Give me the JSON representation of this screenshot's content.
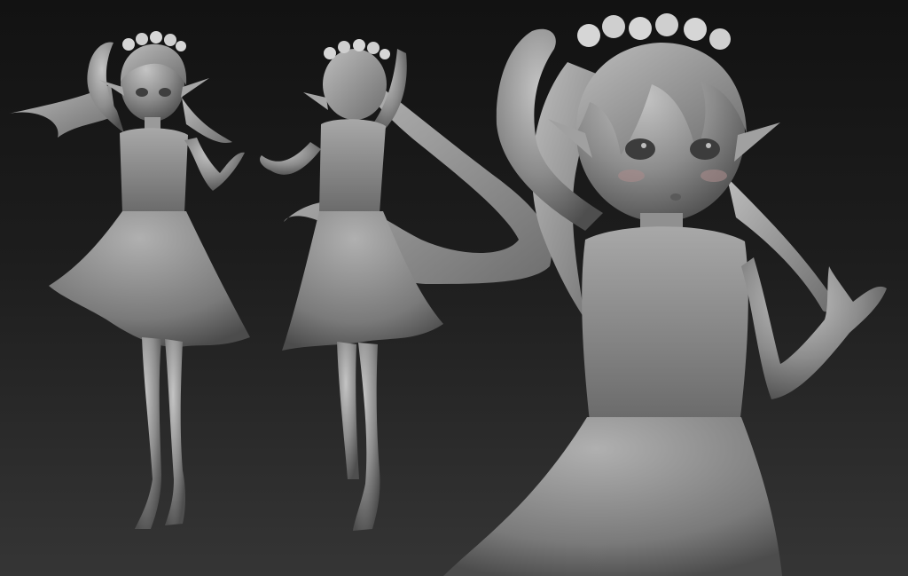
{
  "scene": {
    "background_top": "#121212",
    "background_bottom": "#353535",
    "clay_light": "#b8b8b8",
    "clay_mid": "#8a8a8a",
    "clay_dark": "#4a4a4a",
    "flower_color": "#d6d6d6",
    "blush_color": "#a88a8a"
  },
  "views": [
    {
      "name": "front-view",
      "icon": "figure-front-icon"
    },
    {
      "name": "back-view",
      "icon": "figure-back-icon"
    },
    {
      "name": "closeup-view",
      "icon": "figure-closeup-icon"
    }
  ]
}
